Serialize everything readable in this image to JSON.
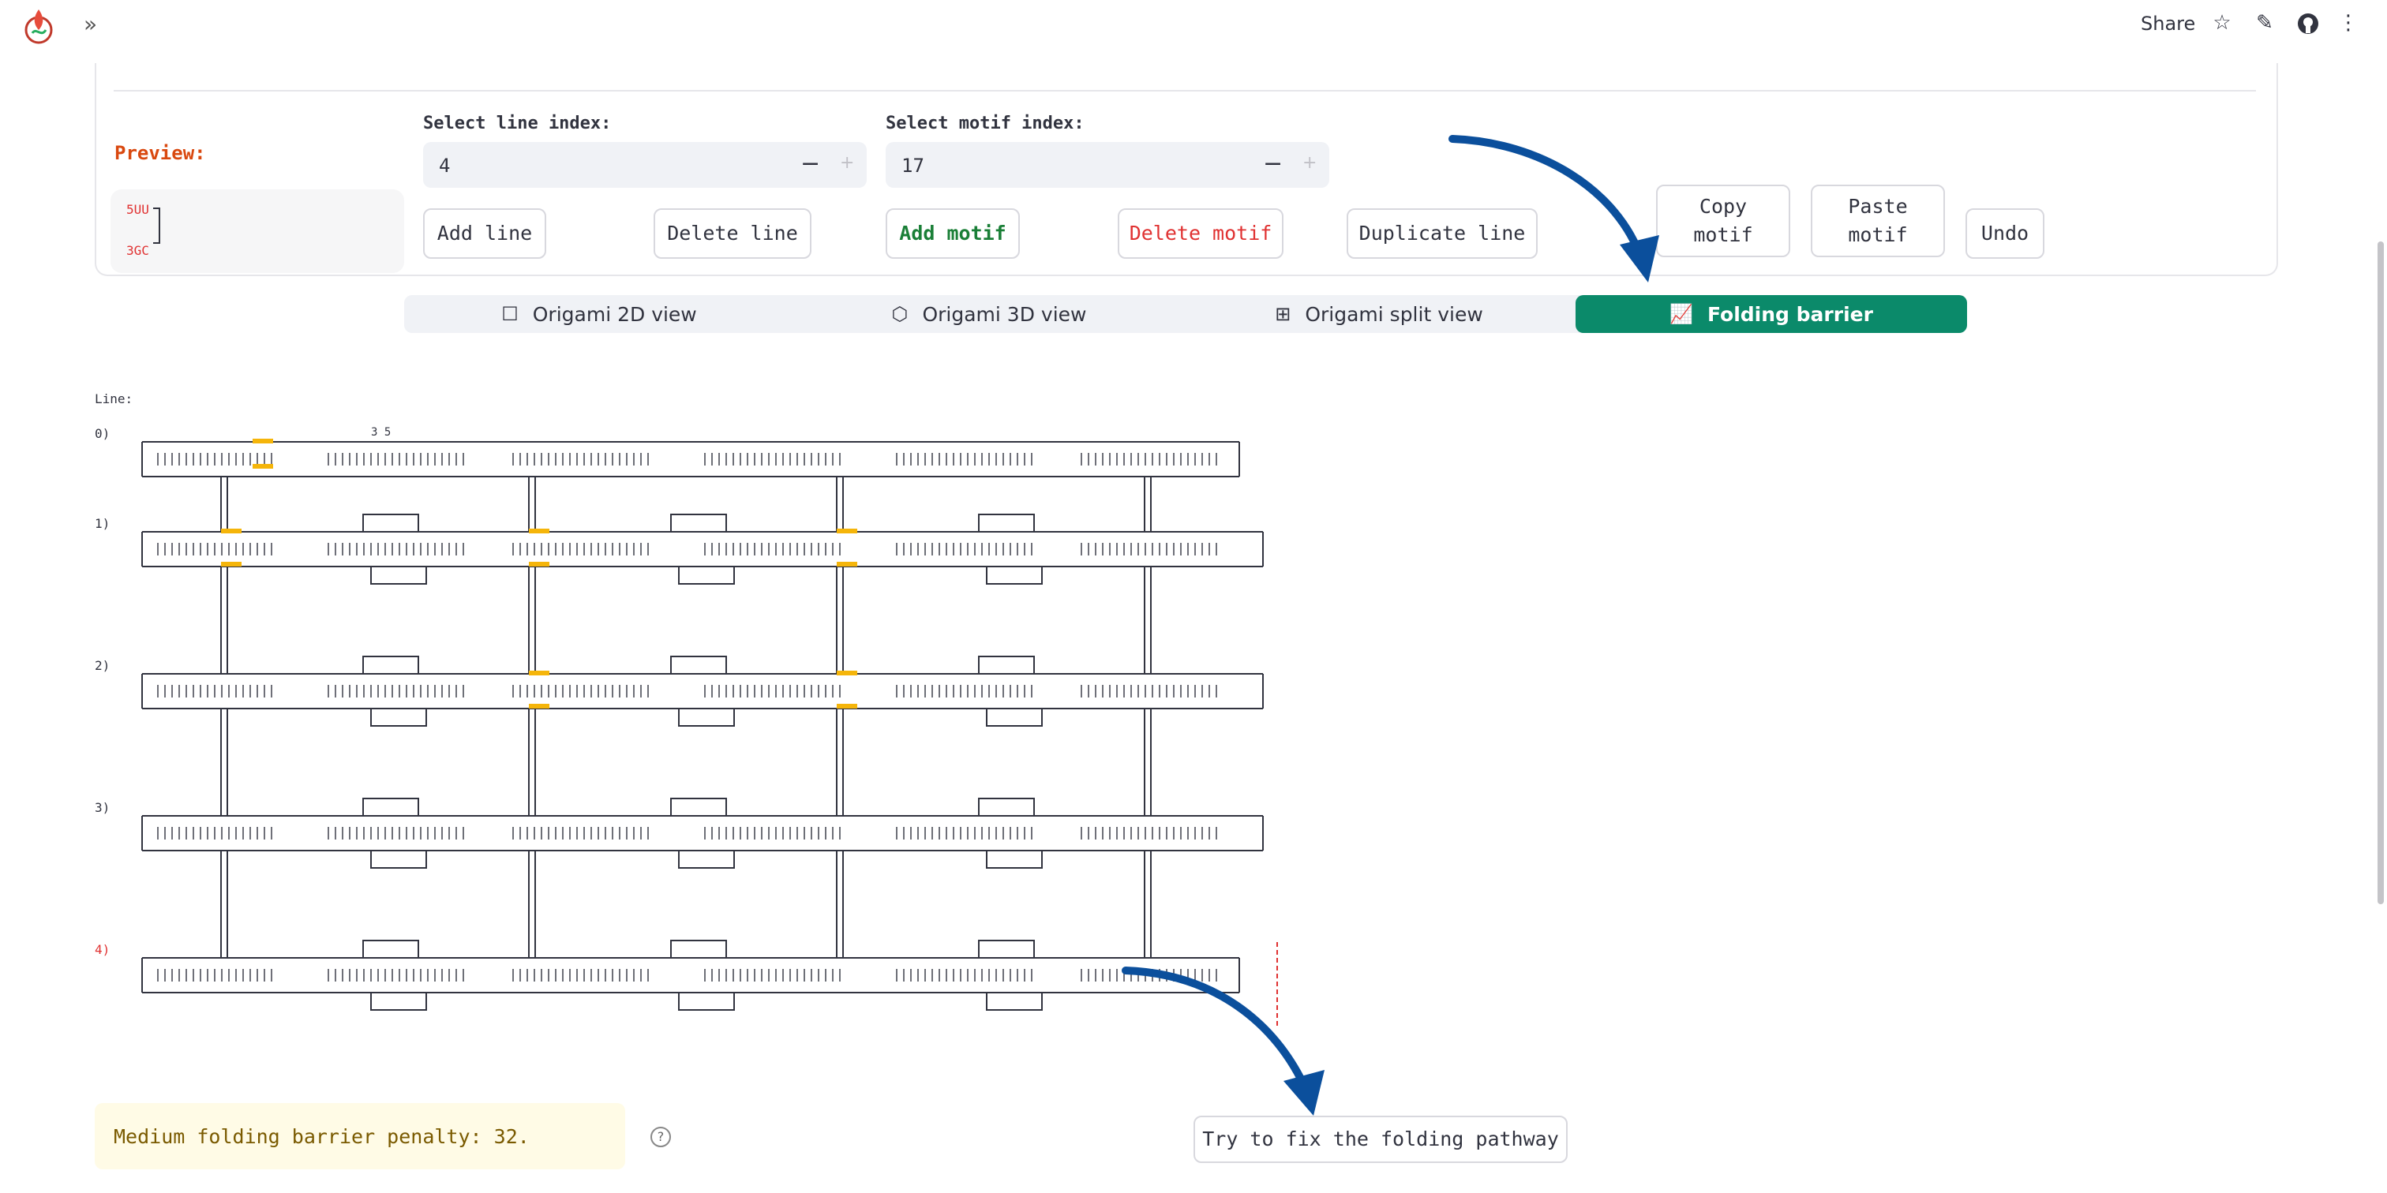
{
  "header": {
    "share_label": "Share",
    "icons": [
      "star-icon",
      "pencil-icon",
      "github-icon",
      "more-vertical-icon"
    ]
  },
  "preview": {
    "label": "Preview:",
    "snippet_top": "5UU",
    "snippet_bottom": "3GC"
  },
  "controls": {
    "line_index_label": "Select line index:",
    "line_index_value": "4",
    "motif_index_label": "Select motif index:",
    "motif_index_value": "17",
    "minus": "−",
    "plus": "+",
    "buttons": {
      "add_line": "Add line",
      "delete_line": "Delete line",
      "add_motif": "Add motif",
      "delete_motif": "Delete motif",
      "duplicate_line": "Duplicate line",
      "copy_motif": "Copy motif",
      "paste_motif": "Paste motif",
      "undo": "Undo"
    },
    "colors": {
      "add_motif": "#1a7f37",
      "delete_motif": "#e03131"
    }
  },
  "tabs": [
    {
      "label": "Origami 2D view",
      "icon": "square-icon",
      "active": false
    },
    {
      "label": "Origami 3D view",
      "icon": "cube-icon",
      "active": false
    },
    {
      "label": "Origami split view",
      "icon": "layout-icon",
      "active": false
    },
    {
      "label": "Folding barrier",
      "icon": "chart-line-icon",
      "active": true
    }
  ],
  "diagram": {
    "header": "Line:",
    "line_labels": [
      "0)",
      "1)",
      "2)",
      "3)",
      "4)"
    ],
    "selected_line": "4)",
    "top_marker": "3 5",
    "highlight_color": "#f5b50a",
    "selected_color": "#e03131"
  },
  "warning": {
    "text": "Medium folding barrier penalty: 32."
  },
  "fix_button": "Try to fix the folding pathway",
  "accent_color": "#0b8a6a"
}
